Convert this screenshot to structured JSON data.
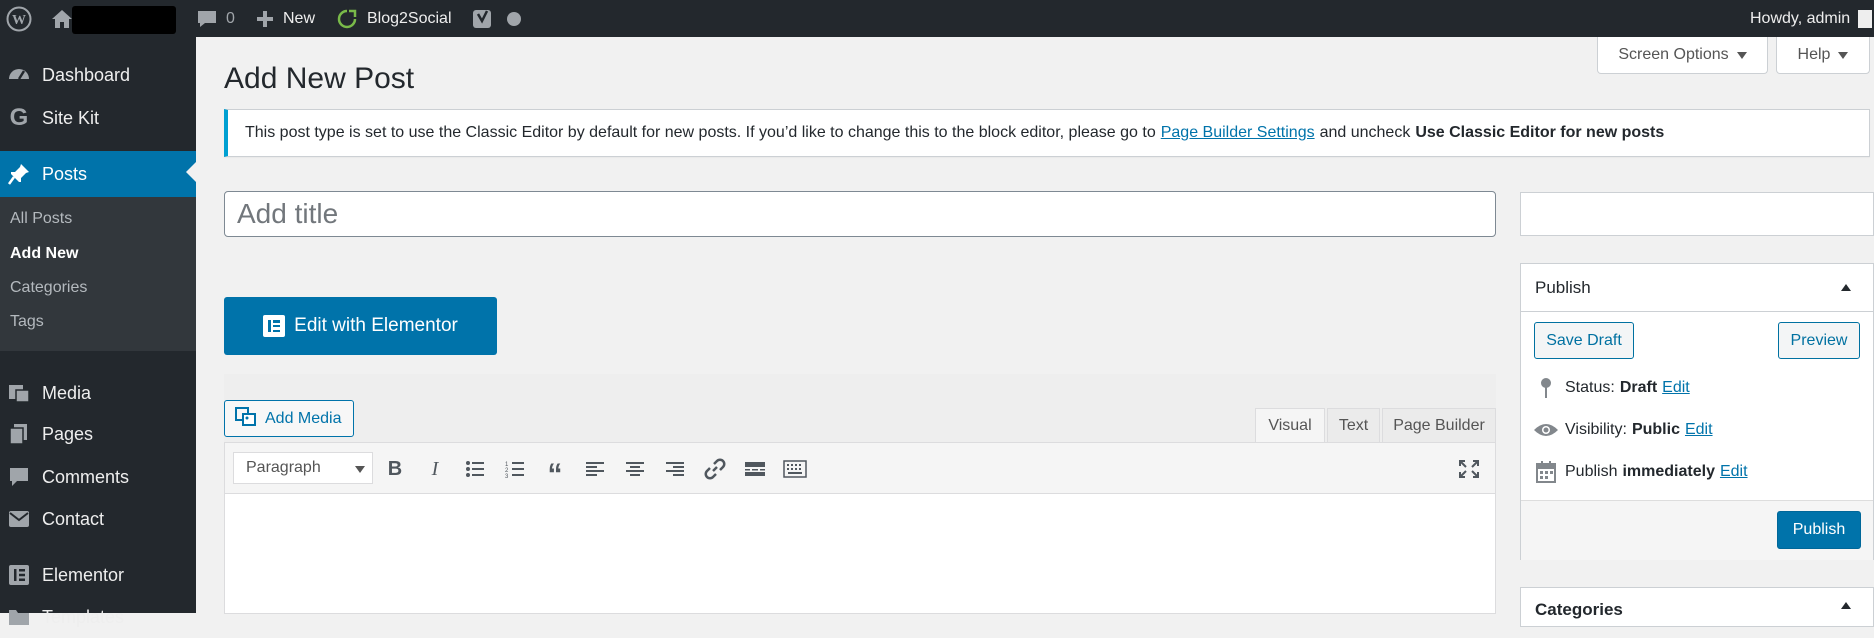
{
  "admin_bar": {
    "comments_count": "0",
    "new_label": "New",
    "blog2social_label": "Blog2Social",
    "howdy": "Howdy, admin"
  },
  "sidebar": {
    "items": [
      {
        "label": "Dashboard",
        "icon": "dashboard-icon"
      },
      {
        "label": "Site Kit",
        "icon": "google-g-icon"
      },
      {
        "label": "Posts",
        "icon": "pushpin-icon"
      },
      {
        "label": "Media",
        "icon": "media-icon"
      },
      {
        "label": "Pages",
        "icon": "pages-icon"
      },
      {
        "label": "Comments",
        "icon": "comment-icon"
      },
      {
        "label": "Contact",
        "icon": "envelope-icon"
      },
      {
        "label": "Elementor",
        "icon": "elementor-icon"
      },
      {
        "label": "Templates",
        "icon": "folder-icon"
      }
    ],
    "submenu": [
      "All Posts",
      "Add New",
      "Categories",
      "Tags"
    ]
  },
  "screen_options": "Screen Options",
  "help": "Help",
  "page_title": "Add New Post",
  "notice": {
    "text_before": "This post type is set to use the Classic Editor by default for new posts. If you’d like to change this to the block editor, please go to",
    "link": "Page Builder Settings",
    "text_mid": "and uncheck",
    "strong": "Use Classic Editor for new posts"
  },
  "title_placeholder": "Add title",
  "elementor_button": "Edit with Elementor",
  "editor": {
    "add_media": "Add Media",
    "tabs": [
      "Visual",
      "Text",
      "Page Builder"
    ],
    "format_select": "Paragraph"
  },
  "publish_box": {
    "title": "Publish",
    "save_draft": "Save Draft",
    "preview": "Preview",
    "status_label": "Status:",
    "status_value": "Draft",
    "visibility_label": "Visibility:",
    "visibility_value": "Public",
    "publish_label": "Publish",
    "publish_value": "immediately",
    "edit": "Edit",
    "publish_button": "Publish"
  },
  "categories_box": {
    "title": "Categories"
  },
  "colors": {
    "accent": "#0073aa",
    "admin_dark": "#23282d",
    "notice_border": "#00a0d2"
  }
}
